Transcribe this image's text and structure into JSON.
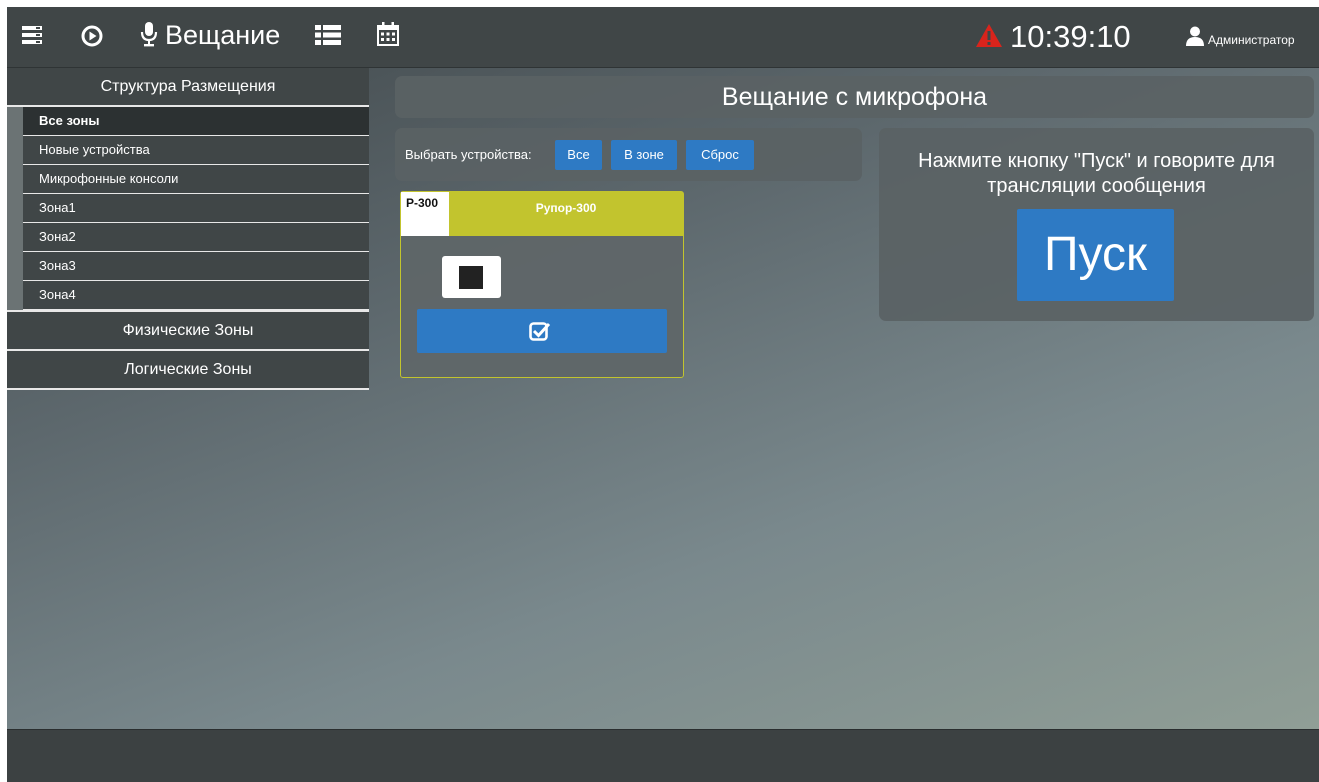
{
  "topbar": {
    "broadcast_label": "Вещание",
    "clock": "10:39:10",
    "user": "Администратор",
    "icons": [
      "server-icon",
      "play-circle-icon",
      "microphone-icon",
      "list-icon",
      "calendar-icon",
      "warning-icon",
      "user-icon"
    ],
    "warning_color": "#d9241c"
  },
  "sidebar": {
    "header": "Структура Размещения",
    "items": [
      {
        "label": "Все зоны",
        "active": true
      },
      {
        "label": "Новые устройства"
      },
      {
        "label": "Микрофонные консоли"
      },
      {
        "label": "Зона1"
      },
      {
        "label": "Зона2"
      },
      {
        "label": "Зона3"
      },
      {
        "label": "Зона4"
      }
    ],
    "sections": [
      "Физические Зоны",
      "Логические Зоны"
    ]
  },
  "main": {
    "title": "Вещание с микрофона",
    "select_label": "Выбрать устройства:",
    "buttons": {
      "all": "Все",
      "in_zone": "В зоне",
      "reset": "Сброс"
    },
    "device": {
      "code": "P-300",
      "name": "Рупор-300",
      "accent": "#c2c42e"
    },
    "instruction": "Нажмите кнопку \"Пуск\" и говорите для трансляции сообщения",
    "start_button": "Пуск"
  },
  "colors": {
    "accent_blue": "#2e7ac4"
  }
}
